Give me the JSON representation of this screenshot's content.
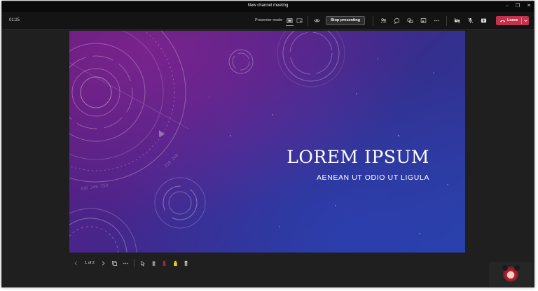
{
  "window": {
    "title": "New channel meeting",
    "controls": [
      "minimize-icon",
      "restore-icon",
      "close-icon"
    ]
  },
  "toolbar": {
    "timer": "01:25",
    "presenter_mode_label": "Presenter mode",
    "stop_presenting_label": "Stop presenting",
    "leave_label": "Leave",
    "icons": [
      "presenter-mode-standout-icon",
      "presenter-mode-content-only-icon",
      "eye-icon",
      "people-icon",
      "chat-icon",
      "reactions-icon",
      "rooms-icon",
      "more-icon",
      "camera-off-icon",
      "mic-off-icon",
      "share-icon"
    ],
    "colors": {
      "leave": "#c4314b",
      "background": "#141414"
    }
  },
  "slide": {
    "title": "LOREM IPSUM",
    "subtitle": "AENEAN UT ODIO UT LIGULA"
  },
  "slide_controls": {
    "page_indicator": "1 of 2",
    "icons": [
      "previous-slide-icon",
      "next-slide-icon",
      "grid-view-icon",
      "more-options-icon",
      "laser-pointer-icon",
      "pen-icon",
      "red-pen-icon",
      "highlighter-icon",
      "eraser-icon"
    ]
  }
}
